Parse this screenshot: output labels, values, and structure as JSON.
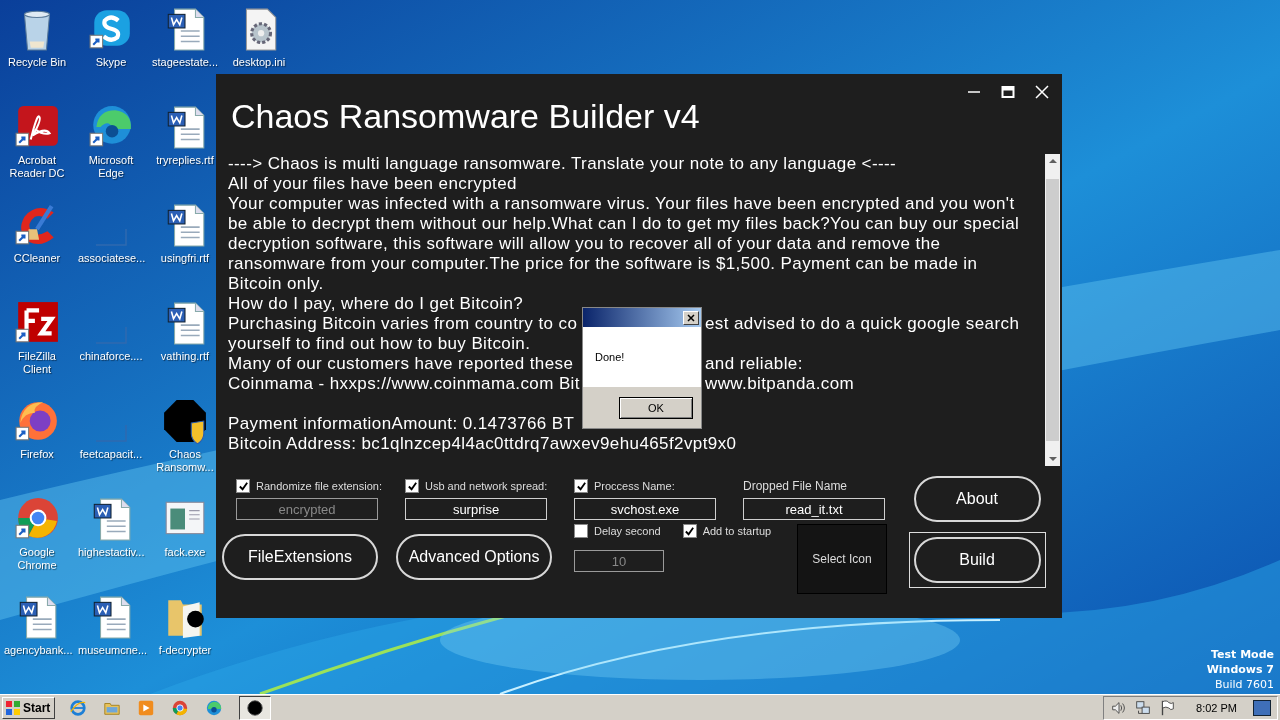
{
  "desktop": {
    "icons": [
      {
        "label": "Recycle Bin",
        "kind": "recycle",
        "shortcut": false
      },
      {
        "label": "Acrobat Reader DC",
        "kind": "pdf",
        "shortcut": true
      },
      {
        "label": "CCleaner",
        "kind": "ccleaner",
        "shortcut": true
      },
      {
        "label": "FileZilla Client",
        "kind": "filezilla",
        "shortcut": true
      },
      {
        "label": "Firefox",
        "kind": "firefox",
        "shortcut": true
      },
      {
        "label": "Google Chrome",
        "kind": "chrome",
        "shortcut": true
      },
      {
        "label": "agencybank...",
        "kind": "word",
        "shortcut": false
      },
      {
        "label": "Skype",
        "kind": "skype",
        "shortcut": true
      },
      {
        "label": "Microsoft Edge",
        "kind": "edge",
        "shortcut": true
      },
      {
        "label": "associatese...",
        "kind": "blank",
        "shortcut": false
      },
      {
        "label": "chinaforce....",
        "kind": "blank",
        "shortcut": false
      },
      {
        "label": "feetcapacit...",
        "kind": "blank",
        "shortcut": false
      },
      {
        "label": "highestactiv...",
        "kind": "word",
        "shortcut": false
      },
      {
        "label": "museumcne...",
        "kind": "word",
        "shortcut": false
      },
      {
        "label": "stageestate...",
        "kind": "word",
        "shortcut": false
      },
      {
        "label": "tryreplies.rtf",
        "kind": "word",
        "shortcut": false
      },
      {
        "label": "usingfri.rtf",
        "kind": "word",
        "shortcut": false
      },
      {
        "label": "vathing.rtf",
        "kind": "word",
        "shortcut": false
      },
      {
        "label": "Chaos Ransomw...",
        "kind": "chaos",
        "shortcut": false
      },
      {
        "label": "fack.exe",
        "kind": "exe",
        "shortcut": false
      },
      {
        "label": "f-decrypter",
        "kind": "folder",
        "shortcut": false
      },
      {
        "label": "desktop.ini",
        "kind": "settings",
        "shortcut": false
      }
    ],
    "watermark": [
      "Test Mode",
      "Windows 7",
      "Build 7601"
    ]
  },
  "window": {
    "title": "Chaos Ransomware Builder v4",
    "note": [
      {
        "lines": [
          {
            "segments": [
              "----> Chaos is multi language ransomware. Translate your note to any language <----"
            ]
          },
          {
            "segments": [
              "All of your files have been encrypted"
            ]
          },
          {
            "segments": [
              "Your computer was infected with a ransomware virus. Your files have been encrypted and you won't be able to decrypt them without our help.What can I do to get my files back?You can buy our special decryption software, this software will allow you to recover all of your data and remove the ransomware from your computer.The price for the software is $1,500. Payment can be made in Bitcoin only."
            ]
          },
          {
            "segments": [
              "How do I pay, where do I get Bitcoin?"
            ]
          },
          {
            "segments": [
              "Purchasing Bitcoin varies from country to co",
              "est advised to do a quick google search"
            ]
          },
          {
            "segments": [
              "yourself  to find out how to buy Bitcoin."
            ]
          },
          {
            "segments": [
              "Many of our customers have reported these",
              "and reliable:"
            ]
          },
          {
            "segments": [
              "Coinmama - hxxps://www.coinmama.com Bit",
              "www.bitpanda.com"
            ]
          }
        ]
      },
      {
        "lines": [
          {
            "segments": [
              "Payment informationAmount: 0.1473766 BT"
            ]
          },
          {
            "segments": [
              "Bitcoin Address:  bc1qlnzcep4l4ac0ttdrq7awxev9ehu465f2vpt9x0"
            ]
          }
        ]
      }
    ],
    "options": [
      {
        "kind": "checkbox",
        "label": "Randomize file extension:",
        "checked": true,
        "value": "encrypted",
        "disabled": true
      },
      {
        "kind": "checkbox",
        "label": "Usb and network spread:",
        "checked": true,
        "value": "surprise",
        "disabled": false
      },
      {
        "kind": "checkbox",
        "label": "Proccess Name:",
        "checked": true,
        "value": "svchost.exe",
        "disabled": false
      },
      {
        "kind": "label",
        "label": "Dropped File Name",
        "value": "read_it.txt",
        "disabled": false
      }
    ],
    "buttons": [
      "FileExtensions",
      "Advanced Options"
    ],
    "delay": {
      "label": "Delay second",
      "checked": false,
      "value": "10",
      "disabled": true
    },
    "startup": {
      "label": "Add to startup",
      "checked": true
    },
    "select_icon": "Select Icon",
    "side_buttons": [
      {
        "label": "About",
        "focused": false
      },
      {
        "label": "Build",
        "focused": true
      }
    ]
  },
  "dialog": {
    "message": "Done!",
    "button": "OK"
  },
  "taskbar": {
    "start": "Start",
    "quick_launch": [
      {
        "kind": "ie"
      },
      {
        "kind": "explorer"
      },
      {
        "kind": "media"
      },
      {
        "kind": "chrome"
      },
      {
        "kind": "edge"
      }
    ],
    "tasks": [
      {
        "kind": "chaos",
        "selected": true
      }
    ],
    "tray": [
      {
        "kind": "speaker"
      },
      {
        "kind": "network"
      },
      {
        "kind": "flag"
      }
    ],
    "clock": "8:02 PM"
  }
}
